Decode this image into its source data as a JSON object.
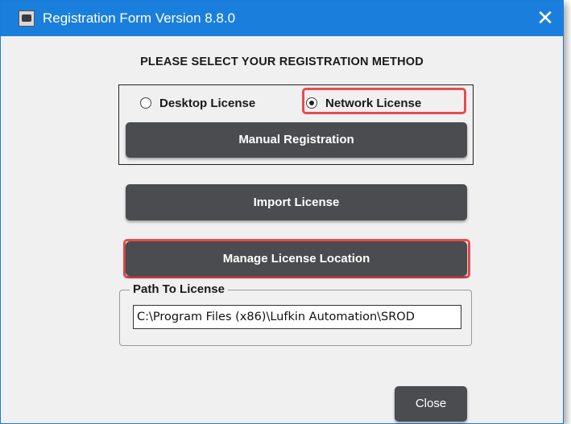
{
  "window": {
    "title": "Registration Form Version 8.8.0",
    "close_glyph": "✕",
    "icon": "registration-app-icon"
  },
  "heading": "PLEASE SELECT YOUR REGISTRATION METHOD",
  "license_type": {
    "options": [
      {
        "label": "Desktop License",
        "selected": false
      },
      {
        "label": "Network License",
        "selected": true
      }
    ]
  },
  "buttons": {
    "manual_registration": "Manual Registration",
    "import_license": "Import License",
    "manage_license_location": "Manage License Location",
    "close": "Close"
  },
  "path_group": {
    "legend": "Path To License",
    "value": "C:\\Program Files (x86)\\Lufkin Automation\\SROD"
  },
  "colors": {
    "titlebar": "#1a7fdc",
    "button": "#4a4c50",
    "highlight": "#e84a4f",
    "background": "#f0f0f0"
  }
}
